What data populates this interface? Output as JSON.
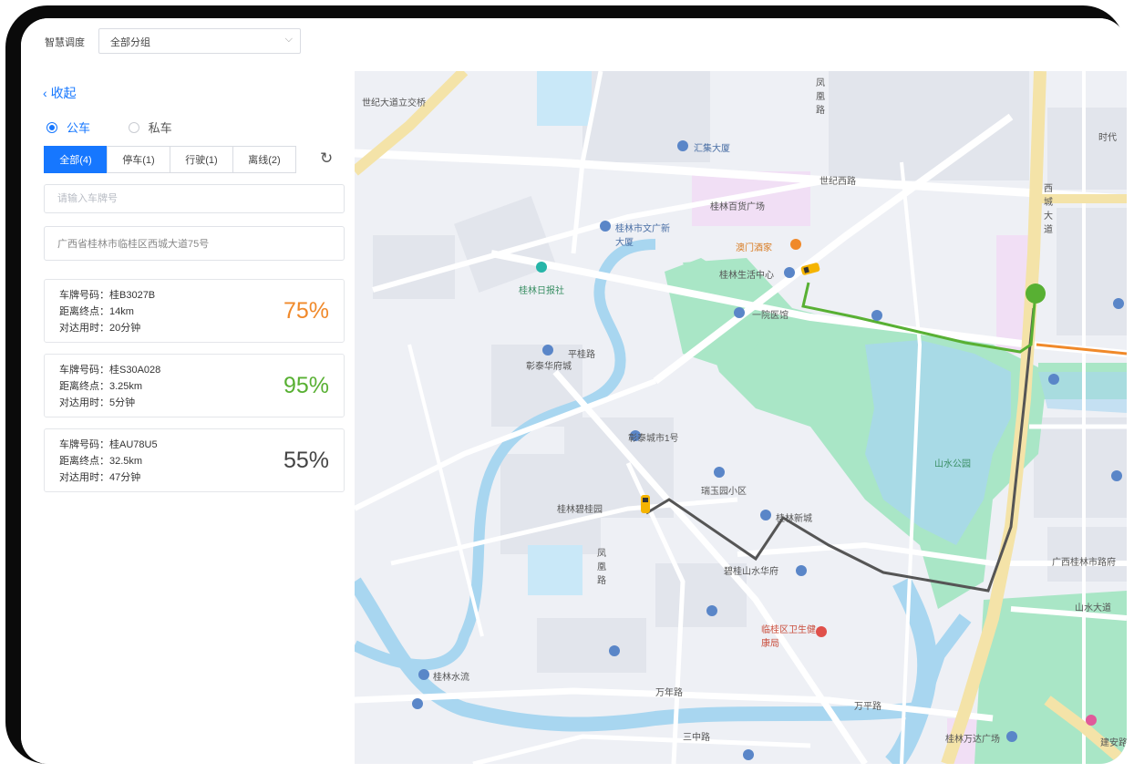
{
  "header": {
    "title": "智慧调度",
    "group_select": "全部分组"
  },
  "panel": {
    "collapse_label": "收起",
    "radios": [
      {
        "label": "公车",
        "selected": true
      },
      {
        "label": "私车",
        "selected": false
      }
    ],
    "tabs": [
      {
        "label": "全部(4)",
        "active": true
      },
      {
        "label": "停车(1)",
        "active": false
      },
      {
        "label": "行驶(1)",
        "active": false
      },
      {
        "label": "离线(2)",
        "active": false
      }
    ],
    "plate_placeholder": "请输入车牌号",
    "address": "广西省桂林市临桂区西城大道75号",
    "cards": [
      {
        "plate": "车牌号码：桂B3027B",
        "distance": "距离终点：14km",
        "eta": "对达用时：20分钟",
        "percent": "75%",
        "color": "#f0892a"
      },
      {
        "plate": "车牌号码：桂S30A028",
        "distance": "距离终点：3.25km",
        "eta": "对达用时：5分钟",
        "percent": "95%",
        "color": "#58b033"
      },
      {
        "plate": "车牌号码：桂AU78U5",
        "distance": "距离终点：32.5km",
        "eta": "对达用时：47分钟",
        "percent": "55%",
        "color": "#444444"
      }
    ]
  },
  "map": {
    "labels": {
      "l1": "桂林百货广场",
      "l2": "桂林市文广新大厦",
      "l3": "桂林生活中心",
      "l4": "一院医馆",
      "l5": "桂林日报社",
      "l6": "彰泰华府城",
      "l7": "彰泰城市1号",
      "l8": "桂林碧桂园",
      "l9": "瑞玉园小区",
      "l10": "桂林新城",
      "l11": "碧桂山水华府",
      "l12": "山水公园",
      "l13": "广西桂林市路府",
      "l14": "山水大道",
      "l15": "临桂区卫生健康局",
      "l16": "万年路",
      "l17": "万平路",
      "l18": "三中路",
      "l19": "桂林水流",
      "l20": "世纪西路",
      "l21": "西城大道",
      "l22": "汇集大厦",
      "l23": "澳门酒家",
      "l24": "桂林万达广场",
      "l25": "世纪大道立交桥",
      "l26": "凤凰路",
      "l27": "平桂路",
      "l28": "凤凰路",
      "l29": "时代",
      "l30": "建安路"
    },
    "colors": {
      "active_route": "#58b033",
      "history_route": "#555555",
      "other_route": "#f0892a",
      "destination": "#58b033",
      "vehicle": "#f5b400"
    }
  }
}
